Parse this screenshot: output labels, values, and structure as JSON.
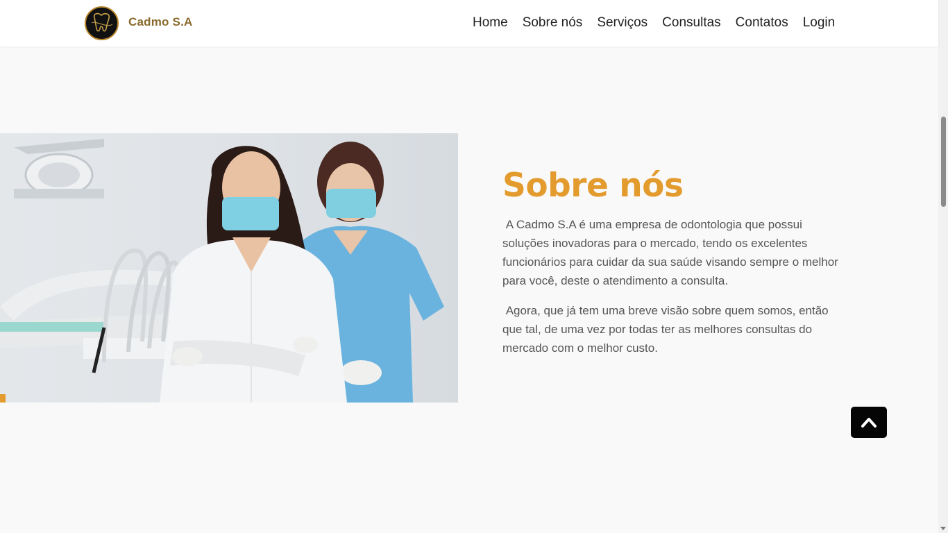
{
  "header": {
    "brand_name": "Cadmo S.A",
    "logo_icon": "tooth-logo-icon",
    "nav": [
      {
        "label": "Home"
      },
      {
        "label": "Sobre nós"
      },
      {
        "label": "Serviços"
      },
      {
        "label": "Consultas"
      },
      {
        "label": "Contatos"
      },
      {
        "label": "Login"
      }
    ]
  },
  "about": {
    "title": "Sobre nós",
    "paragraphs": [
      " A Cadmo S.A é uma empresa de odontologia que possui soluções inovadoras para o mercado, tendo os excelentes funcionários para cuidar da sua saúde visando sempre o melhor para você, deste o atendimento a consulta.",
      " Agora, que já tem uma breve visão sobre quem somos, então que tal, de uma vez por todas ter as melhores consultas do mercado com o melhor custo."
    ],
    "image": "two-dentists-wearing-masks-photo"
  },
  "back_to_top": {
    "icon": "chevron-up-icon"
  },
  "colors": {
    "accent": "#e39b2e",
    "brand": "#8a6a2c",
    "background": "#f9f9f9",
    "text": "#555555",
    "nav_text": "#222222"
  }
}
